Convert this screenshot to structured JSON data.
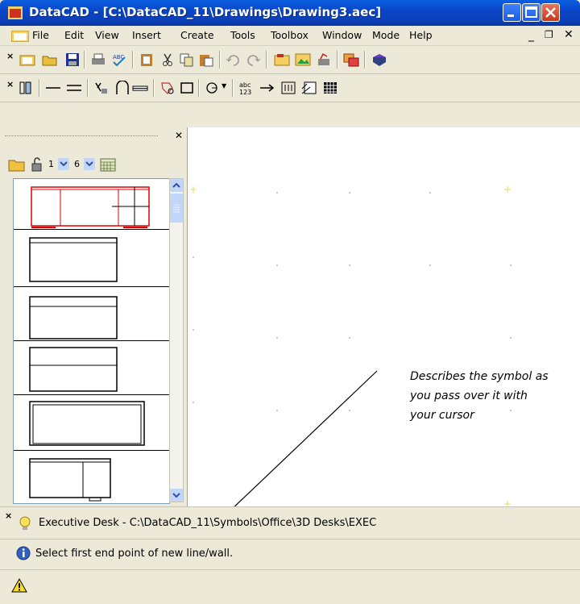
{
  "window": {
    "title": "DataCAD - [C:\\DataCAD_11\\Drawings\\Drawing3.aec]"
  },
  "menu": {
    "items": [
      "File",
      "Edit",
      "View",
      "Insert",
      "Create",
      "Tools",
      "Toolbox",
      "Window",
      "Mode",
      "Help"
    ]
  },
  "sidepanel": {
    "layer_value": "1",
    "layer2_value": "6"
  },
  "symbol_bar": {
    "text": "Executive Desk - C:\\DataCAD_11\\Symbols\\Office\\3D Desks\\EXEC"
  },
  "prompt_bar": {
    "text": "Select first end point of new line/wall."
  },
  "annotation": {
    "text": "Describes the symbol as you pass over it with your cursor"
  },
  "colors": {
    "titlebar": "#0a46c8",
    "selected_symbol": "#e00000"
  }
}
